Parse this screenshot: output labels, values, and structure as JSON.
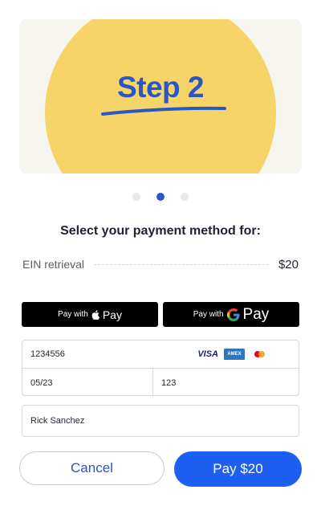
{
  "hero": {
    "title": "Step 2"
  },
  "carousel": {
    "count": 3,
    "active": 2
  },
  "payment": {
    "heading": "Select your payment method for:",
    "item_name": "EIN retrieval",
    "item_price": "$20"
  },
  "wallets": {
    "apple_prefix": "Pay with",
    "apple_label": "Pay",
    "google_prefix": "Pay with",
    "google_label": "Pay"
  },
  "card": {
    "number": "1234556",
    "expiry": "05/23",
    "cvc": "123",
    "brands": {
      "visa": "VISA",
      "amex": "AMEX"
    }
  },
  "cardholder": {
    "name": "Rick Sanchez"
  },
  "actions": {
    "cancel_label": "Cancel",
    "pay_label": "Pay $20"
  },
  "colors": {
    "accent": "#1d5ff0",
    "brand_blue": "#2a56c6",
    "hero_yellow": "#f6d468"
  }
}
